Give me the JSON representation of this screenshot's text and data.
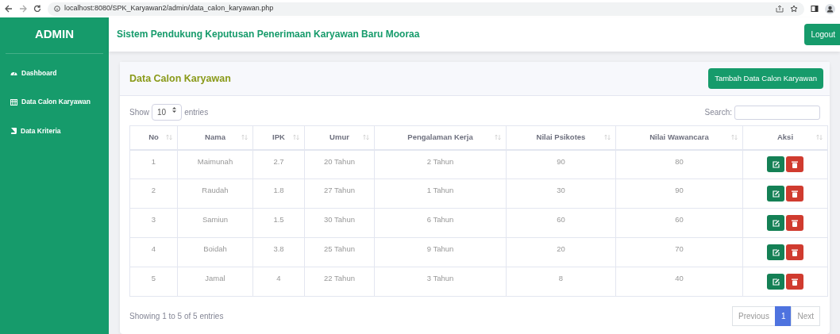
{
  "browser": {
    "url": "localhost:8080/SPK_Karyawan2/admin/data_calon_karyawan.php"
  },
  "sidebar": {
    "brand": "ADMIN",
    "items": [
      {
        "label": "Dashboard"
      },
      {
        "label": "Data Calon Karyawan"
      },
      {
        "label": "Data Kriteria"
      }
    ]
  },
  "navbar": {
    "title": "Sistem Pendukung Keputusan Penerimaan Karyawan Baru Mooraa",
    "logout": "Logout"
  },
  "card": {
    "title": "Data Calon Karyawan",
    "add_button": "Tambah Data Calon Karyawan"
  },
  "table_controls": {
    "show": "Show",
    "page_size": "10",
    "entries": "entries",
    "search_label": "Search:"
  },
  "table": {
    "columns": [
      "No",
      "Nama",
      "IPK",
      "Umur",
      "Pengalaman Kerja",
      "Nilai Psikotes",
      "Nilai Wawancara",
      "Aksi"
    ],
    "rows": [
      [
        "1",
        "Maimunah",
        "2.7",
        "20 Tahun",
        "2 Tahun",
        "90",
        "80"
      ],
      [
        "2",
        "Raudah",
        "1.8",
        "27 Tahun",
        "1 Tahun",
        "30",
        "90"
      ],
      [
        "3",
        "Samiun",
        "1.5",
        "30 Tahun",
        "6 Tahun",
        "60",
        "60"
      ],
      [
        "4",
        "Boidah",
        "3.8",
        "25 Tahun",
        "9 Tahun",
        "20",
        "70"
      ],
      [
        "5",
        "Jamal",
        "4",
        "22 Tahun",
        "3 Tahun",
        "8",
        "40"
      ]
    ]
  },
  "footer": {
    "info": "Showing 1 to 5 of 5 entries",
    "pages": [
      {
        "label": "Previous",
        "selected": false,
        "disabled": true
      },
      {
        "label": "1",
        "selected": true,
        "disabled": false
      },
      {
        "label": "Next",
        "selected": false,
        "disabled": true
      }
    ]
  }
}
